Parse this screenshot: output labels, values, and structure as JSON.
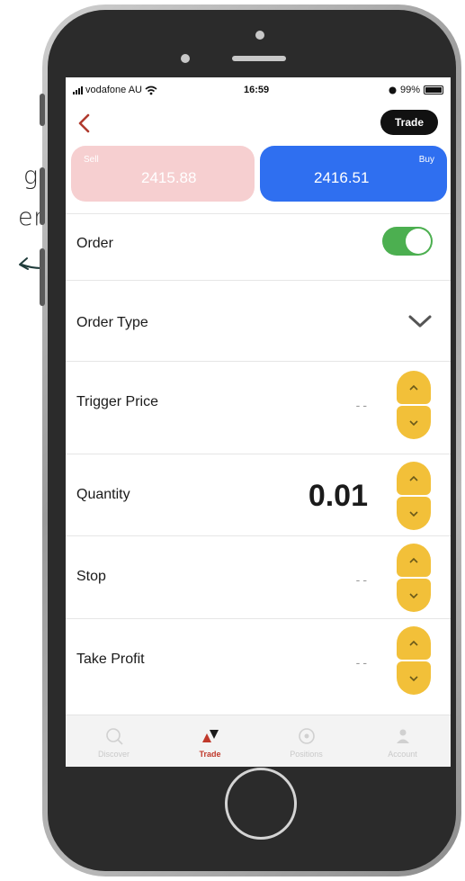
{
  "annotation": {
    "fragment_1": "g",
    "fragment_2": "er"
  },
  "status_bar": {
    "carrier": "vodafone AU",
    "time": "16:59",
    "battery": "99%",
    "battery_level": 0.99
  },
  "header": {
    "trade_button": "Trade"
  },
  "prices": {
    "sell_label": "Sell",
    "sell_price": "2415.88",
    "buy_label": "Buy",
    "buy_price": "2416.51"
  },
  "form": {
    "order_label": "Order",
    "order_toggle_on": true,
    "order_type_label": "Order Type",
    "trigger_price_label": "Trigger Price",
    "trigger_price_value": "--",
    "quantity_label": "Quantity",
    "quantity_value": "0.01",
    "stop_label": "Stop",
    "stop_value": "--",
    "take_profit_label": "Take Profit",
    "take_profit_value": "--"
  },
  "tabbar": {
    "tabs": [
      {
        "label": "Discover",
        "icon": "search-icon",
        "active": false
      },
      {
        "label": "Trade",
        "icon": "trade-icon",
        "active": true
      },
      {
        "label": "Positions",
        "icon": "positions-icon",
        "active": false
      },
      {
        "label": "Account",
        "icon": "account-icon",
        "active": false
      }
    ]
  },
  "colors": {
    "sell_bg": "#f6cfd0",
    "buy_bg": "#2f6ff0",
    "toggle_on": "#4caf50",
    "stepper": "#f2c039",
    "active_tab": "#c0392b"
  }
}
